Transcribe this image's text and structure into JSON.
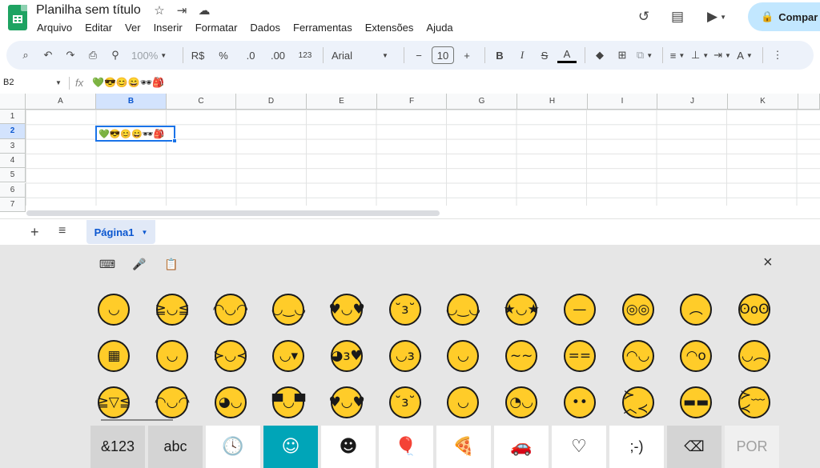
{
  "title": {
    "doc_name": "Planilha sem título",
    "icons": [
      "star-icon",
      "move-folder-icon",
      "cloud-status-icon"
    ]
  },
  "menu": [
    "Arquivo",
    "Editar",
    "Ver",
    "Inserir",
    "Formatar",
    "Dados",
    "Ferramentas",
    "Extensões",
    "Ajuda"
  ],
  "top_right": {
    "share_label": "Compar",
    "icons": [
      "history-icon",
      "comments-icon",
      "meet-icon",
      "lock-icon"
    ]
  },
  "toolbar": {
    "zoom": "100%",
    "currency": "R$",
    "percent": "%",
    "decrease_decimals": ".0",
    "increase_decimals": ".00",
    "number_format": "123",
    "font": "Arial",
    "font_size": "10",
    "bold": "B",
    "italic": "I",
    "text_color": "A"
  },
  "formula_bar": {
    "name_box": "B2",
    "fx_label": "fx",
    "content": "💚😎😊😄🕶🎒"
  },
  "grid": {
    "columns": [
      "A",
      "B",
      "C",
      "D",
      "E",
      "F",
      "G",
      "H",
      "I",
      "J",
      "K"
    ],
    "rows": [
      "1",
      "2",
      "3",
      "4",
      "5",
      "6",
      "7"
    ],
    "active_column": "B",
    "active_row": "2",
    "selected_cell_value": "💚😎😊😄🕶🎒"
  },
  "sheets": {
    "add_icon": "+",
    "list_icon": "≡",
    "tabs": [
      {
        "label": "Página1",
        "active": true
      }
    ]
  },
  "keyboard": {
    "top_icons": [
      "keyboard-icon",
      "microphone-icon",
      "clipboard-icon"
    ],
    "close_icon": "×",
    "emoji_faces": [
      [
        "◡",
        "≧◡≦",
        "◠◡◠",
        "◡‿◡",
        "♥◡♥",
        "˘з˘",
        "◡‿◡",
        "★◡★",
        "—",
        "◎◎",
        "︵",
        "ʘoʘ"
      ],
      [
        "▦",
        "◡",
        "≻◡≺",
        "◡▾",
        "◕з♥",
        "◡з",
        "◡",
        "~~",
        "==",
        "◠◡",
        "◠o",
        "◡︵"
      ],
      [
        "≧▽≦",
        "◠◡◠",
        "◕◡",
        "▀◡▀",
        "♥◡♥",
        "˘з˘",
        "◡",
        "◔◡",
        "••",
        "≻︿≺",
        "▬▬",
        "≻﹏≺"
      ]
    ],
    "bottom_keys": [
      {
        "name": "symbols-key",
        "label": "&123"
      },
      {
        "name": "abc-key",
        "label": "abc"
      },
      {
        "name": "recent-key",
        "label": "🕓"
      },
      {
        "name": "emoji-key",
        "label": "☺"
      },
      {
        "name": "people-key",
        "label": "☻"
      },
      {
        "name": "celebration-key",
        "label": "🎈"
      },
      {
        "name": "food-key",
        "label": "🍕"
      },
      {
        "name": "travel-key",
        "label": "🚗"
      },
      {
        "name": "heart-key",
        "label": "♡"
      },
      {
        "name": "kaomoji-key",
        "label": ";-)"
      },
      {
        "name": "backspace-key",
        "label": "⌫"
      },
      {
        "name": "language-key",
        "label": "POR"
      }
    ]
  }
}
